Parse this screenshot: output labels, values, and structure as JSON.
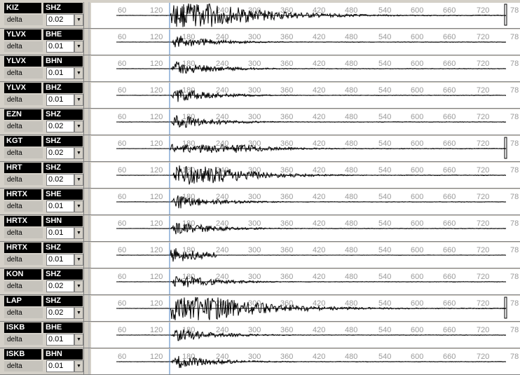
{
  "delta_label": "delta",
  "time_ticks": [
    "60",
    "120",
    "180",
    "240",
    "300",
    "360",
    "420",
    "480",
    "540",
    "600",
    "660",
    "720",
    "78"
  ],
  "spin_glyph": "▼",
  "tracks": [
    {
      "station": "KIZ",
      "channel": "SHZ",
      "delta": "0.02",
      "style": "saturated"
    },
    {
      "station": "YLVX",
      "channel": "BHE",
      "delta": "0.01",
      "style": "normal"
    },
    {
      "station": "YLVX",
      "channel": "BHN",
      "delta": "0.01",
      "style": "normal"
    },
    {
      "station": "YLVX",
      "channel": "BHZ",
      "delta": "0.01",
      "style": "normal"
    },
    {
      "station": "EZN",
      "channel": "SHZ",
      "delta": "0.02",
      "style": "normal"
    },
    {
      "station": "KGT",
      "channel": "SHZ",
      "delta": "0.02",
      "style": "band"
    },
    {
      "station": "HRT",
      "channel": "SHZ",
      "delta": "0.02",
      "style": "strong"
    },
    {
      "station": "HRTX",
      "channel": "SHE",
      "delta": "0.01",
      "style": "normal"
    },
    {
      "station": "HRTX",
      "channel": "SHN",
      "delta": "0.01",
      "style": "normal"
    },
    {
      "station": "HRTX",
      "channel": "SHZ",
      "delta": "0.01",
      "style": "short"
    },
    {
      "station": "KON",
      "channel": "SHZ",
      "delta": "0.02",
      "style": "normal"
    },
    {
      "station": "LAP",
      "channel": "SHZ",
      "delta": "0.02",
      "style": "saturated"
    },
    {
      "station": "ISKB",
      "channel": "BHE",
      "delta": "0.01",
      "style": "normal"
    },
    {
      "station": "ISKB",
      "channel": "BHN",
      "delta": "0.01",
      "style": "normal"
    }
  ]
}
